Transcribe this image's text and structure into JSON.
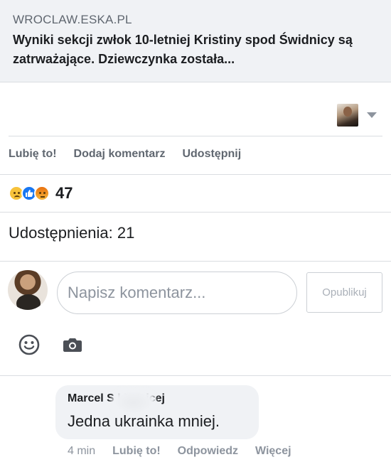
{
  "link_preview": {
    "domain": "WROCLAW.ESKA.PL",
    "title": "Wyniki sekcji zwłok 10-letniej Kristiny spod Świdnicy są zatrważające. Dziewczynka została..."
  },
  "actions": {
    "like": "Lubię to!",
    "comment": "Dodaj komentarz",
    "share": "Udostępnij"
  },
  "reactions": {
    "icons": [
      "sad-reaction",
      "like-reaction",
      "angry-reaction"
    ],
    "count": "47"
  },
  "shares": {
    "text": "Udostępnienia: 21"
  },
  "composer": {
    "placeholder": "Napisz komentarz...",
    "publish_label": "Opublikuj",
    "tools": [
      "emoji-icon",
      "camera-icon"
    ]
  },
  "comment": {
    "author": "Marcel S          ki Majcej",
    "text": "Jedna ukrainka mniej.",
    "time": "4 min",
    "like": "Lubię to!",
    "reply": "Odpowiedz",
    "more": "Więcej"
  },
  "colors": {
    "accent": "#1877f2",
    "muted_text": "#606770",
    "preview_bg": "#f0f2f5"
  }
}
